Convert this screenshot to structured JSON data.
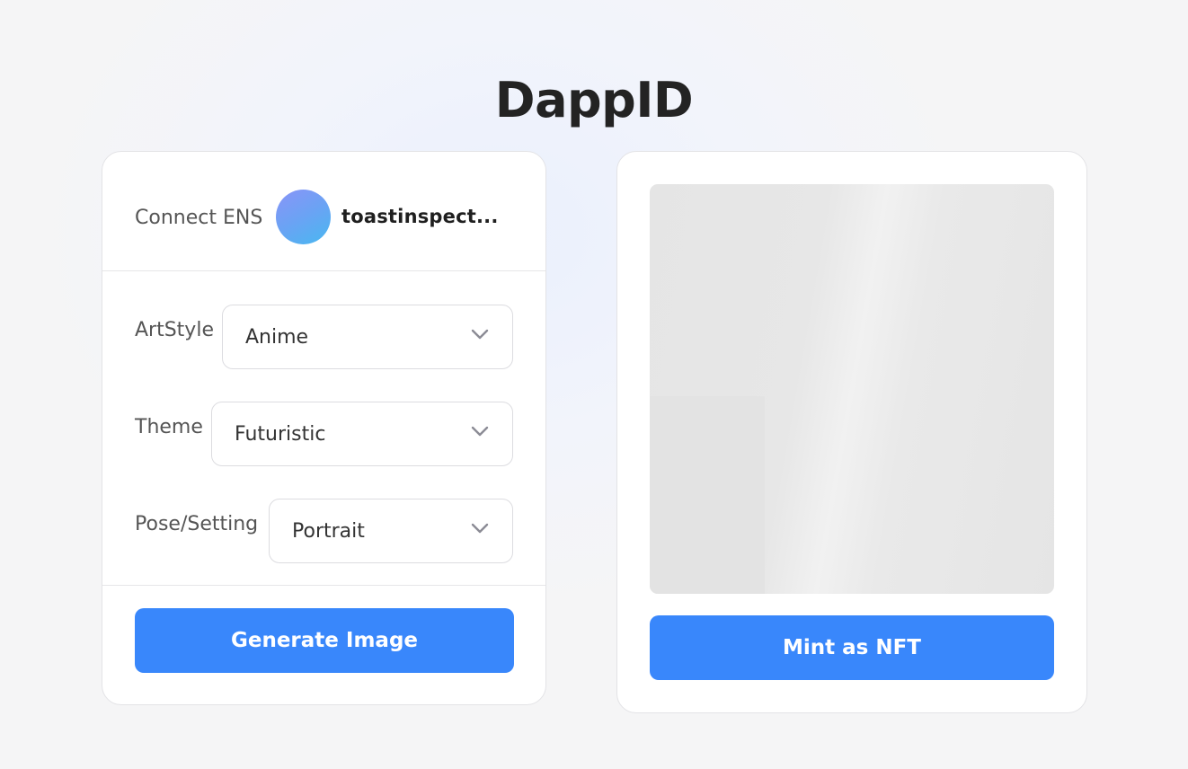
{
  "app": {
    "title": "DappID"
  },
  "ens": {
    "label": "Connect ENS",
    "name": "toastinspect..."
  },
  "form": {
    "artstyle": {
      "label": "ArtStyle",
      "value": "Anime"
    },
    "theme": {
      "label": "Theme",
      "value": "Futuristic"
    },
    "pose": {
      "label": "Pose/Setting",
      "value": "Portrait"
    }
  },
  "actions": {
    "generate_label": "Generate Image",
    "mint_label": "Mint as NFT"
  },
  "colors": {
    "primary_button": "#3987fb",
    "avatar_gradient_start": "#8a94f7",
    "avatar_gradient_end": "#48b8f0"
  },
  "icons": {
    "select_chevron": "chevron-down-icon"
  }
}
